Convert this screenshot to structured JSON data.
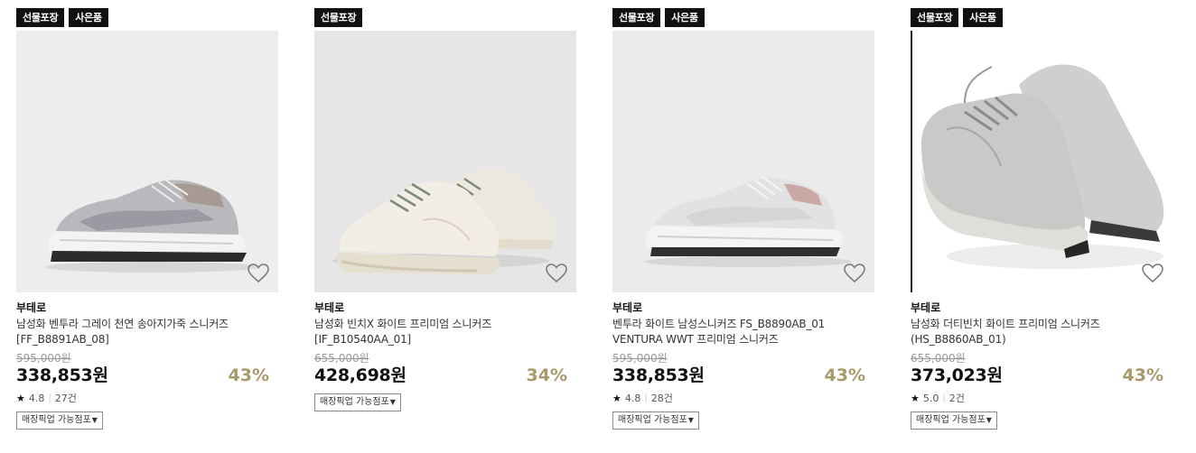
{
  "products": [
    {
      "badges": [
        "선물포장",
        "사은품"
      ],
      "brand": "부테로",
      "name_line1": "남성화 벤투라 그레이 천연 송아지가죽 스니커즈",
      "name_line2": "[FF_B8891AB_08]",
      "original_price": "595,000원",
      "sale_price": "338,853원",
      "discount": "43%",
      "rating": "4.8",
      "review_count": "27건",
      "pickup_label": "매장픽업 가능점포",
      "shoe_color": "#b9b9bd",
      "bg_color": "#ededed"
    },
    {
      "badges": [
        "선물포장"
      ],
      "brand": "부테로",
      "name_line1": "남성화 빈치X 화이트 프리미엄 스니커즈",
      "name_line2": "[IF_B10540AA_01]",
      "original_price": "655,000원",
      "sale_price": "428,698원",
      "discount": "34%",
      "rating": "",
      "review_count": "",
      "pickup_label": "매장픽업 가능점포",
      "shoe_color": "#efebe1",
      "bg_color": "#e6e6e6"
    },
    {
      "badges": [
        "선물포장",
        "사은품"
      ],
      "brand": "부테로",
      "name_line1": "벤투라 화이트 남성스니커즈 FS_B8890AB_01",
      "name_line2": "VENTURA WWT 프리미엄 스니커즈",
      "original_price": "595,000원",
      "sale_price": "338,853원",
      "discount": "43%",
      "rating": "4.8",
      "review_count": "28건",
      "pickup_label": "매장픽업 가능점포",
      "shoe_color": "#e2e2e2",
      "bg_color": "#ebebeb"
    },
    {
      "badges": [
        "선물포장",
        "사은품"
      ],
      "brand": "부테로",
      "name_line1": "남성화 더티빈치 화이트 프리미엄 스니커즈",
      "name_line2": "(HS_B8860AB_01)",
      "original_price": "655,000원",
      "sale_price": "373,023원",
      "discount": "43%",
      "rating": "5.0",
      "review_count": "2건",
      "pickup_label": "매장픽업 가능점포",
      "shoe_color": "#c9c9c7",
      "bg_color": "#ffffff"
    }
  ],
  "icons": {
    "wishlist": "heart-outline-icon",
    "rating": "star-icon",
    "dropdown": "triangle-down-icon"
  }
}
